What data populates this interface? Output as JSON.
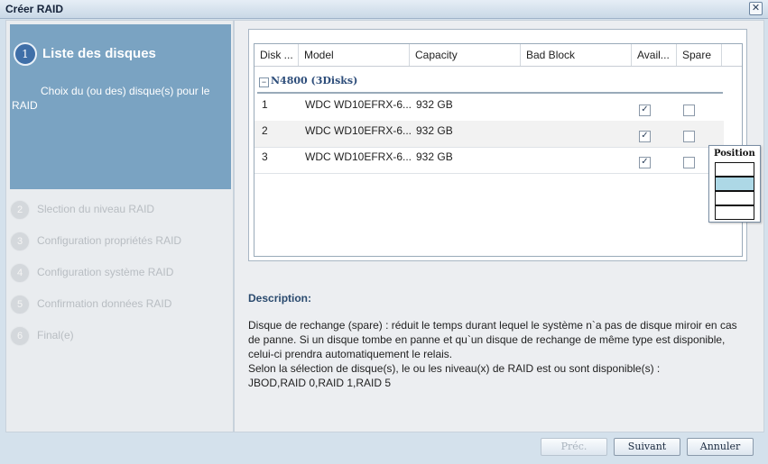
{
  "window": {
    "title": "Créer RAID",
    "close_label": "✕"
  },
  "steps": {
    "active": {
      "number": "1",
      "label": "Liste des disques",
      "description": "Choix du (ou des) disque(s) pour le RAID"
    },
    "items": [
      {
        "number": "2",
        "label": "Slection du niveau RAID"
      },
      {
        "number": "3",
        "label": "Configuration propriétés RAID"
      },
      {
        "number": "4",
        "label": "Configuration système RAID"
      },
      {
        "number": "5",
        "label": "Confirmation données RAID"
      },
      {
        "number": "6",
        "label": "Final(e)"
      }
    ]
  },
  "table": {
    "columns": [
      "Disk ...",
      "Model",
      "Capacity",
      "Bad Block",
      "Avail...",
      "Spare"
    ],
    "group": {
      "toggle": "−",
      "label": "N4800 (3Disks)"
    },
    "rows": [
      {
        "disk": "1",
        "model": "WDC WD10EFRX-6...",
        "capacity": "932 GB",
        "bad_block": "",
        "available": true,
        "spare": false
      },
      {
        "disk": "2",
        "model": "WDC WD10EFRX-6...",
        "capacity": "932 GB",
        "bad_block": "",
        "available": true,
        "spare": false
      },
      {
        "disk": "3",
        "model": "WDC WD10EFRX-6...",
        "capacity": "932 GB",
        "bad_block": "",
        "available": true,
        "spare": false
      }
    ]
  },
  "position_popup": {
    "title": "Position",
    "selected_slot": 2
  },
  "description": {
    "title": "Description:",
    "line1": "Disque de rechange (spare) : réduit le temps durant lequel le système n`a pas de disque miroir en cas de panne. Si un disque tombe en panne et qu`un disque de rechange de même type est disponible, celui-ci prendra automatiquement le relais.",
    "line2": "Selon la sélection de disque(s), le ou les niveau(x) de RAID est ou sont disponible(s) :",
    "line3": "JBOD,RAID 0,RAID 1,RAID 5"
  },
  "buttons": {
    "prev": "Préc.",
    "next": "Suivant",
    "cancel": "Annuler"
  }
}
